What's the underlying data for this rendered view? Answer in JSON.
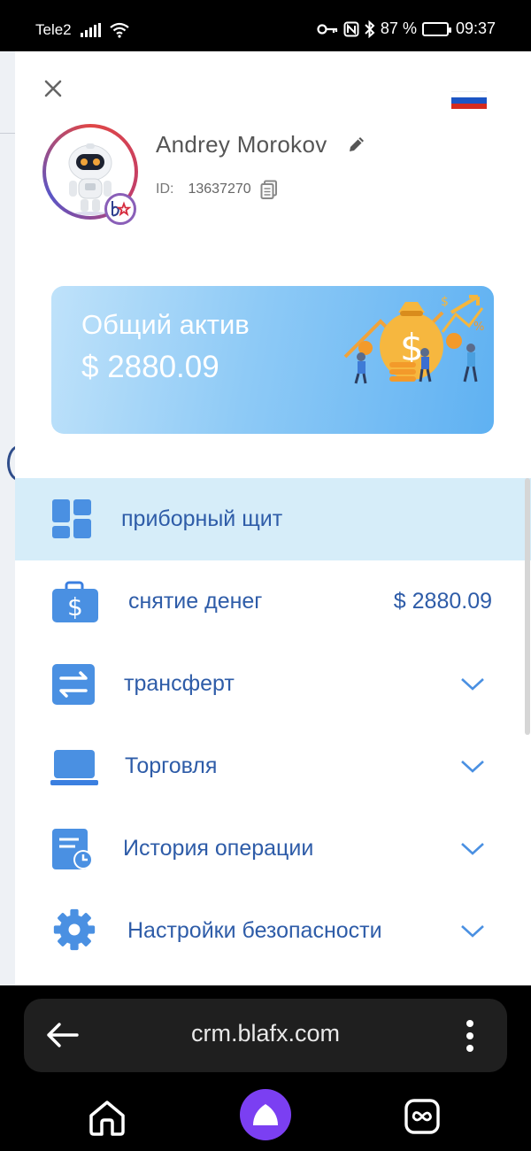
{
  "status_bar": {
    "carrier": "Tele2",
    "battery_percent": "87 %",
    "time": "09:37",
    "icons": [
      "signal-icon",
      "wifi-icon",
      "key-icon",
      "nfc-icon",
      "bluetooth-icon",
      "battery-icon"
    ]
  },
  "drawer": {
    "profile": {
      "name": "Andrey Morokov",
      "id_label": "ID:",
      "id_value": "13637270"
    },
    "language_flag": "russia-flag-icon",
    "asset_card": {
      "title": "Общий актив",
      "value": "$ 2880.09"
    },
    "menu": [
      {
        "label": "приборный щит",
        "icon": "dashboard-icon",
        "active": true
      },
      {
        "label": "снятие денег",
        "icon": "wallet-dollar-icon",
        "amount": "$ 2880.09"
      },
      {
        "label": "трансферт",
        "icon": "transfer-icon",
        "expandable": true
      },
      {
        "label": "Торговля",
        "icon": "laptop-icon",
        "expandable": true
      },
      {
        "label": "История операции",
        "icon": "history-icon",
        "expandable": true
      },
      {
        "label": "Настройки безопасности",
        "icon": "gear-icon",
        "expandable": true
      }
    ],
    "colors": {
      "accent": "#2e5ca8",
      "active_bg": "#d6edf9",
      "card_gradient_end": "#5fb1f2"
    }
  },
  "browser": {
    "url": "crm.blafx.com"
  }
}
